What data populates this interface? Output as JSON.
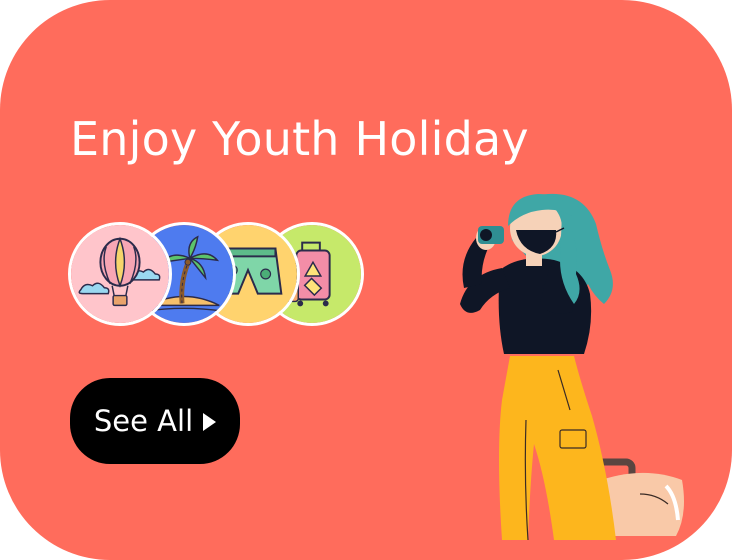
{
  "card": {
    "background_color": "#FF6C5C"
  },
  "title": "Enjoy Youth Holiday",
  "badges": [
    {
      "icon": "hot-air-balloon-icon",
      "bg_color": "#FFC5CB"
    },
    {
      "icon": "palm-island-icon",
      "bg_color": "#4E7BEF"
    },
    {
      "icon": "swim-shorts-icon",
      "bg_color": "#FFD36E"
    },
    {
      "icon": "luggage-icon",
      "bg_color": "#C6E96A"
    }
  ],
  "see_all": {
    "label": "See All",
    "icon": "play-triangle-icon"
  },
  "illustration": {
    "icon": "traveler-with-camera-illustration"
  }
}
